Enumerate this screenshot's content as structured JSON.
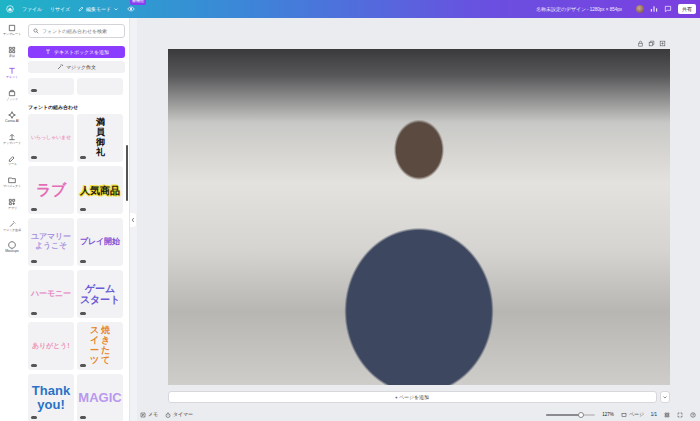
{
  "topbar": {
    "menus": [
      "ファイル",
      "リサイズ"
    ],
    "mode": "編集モード",
    "mode_badge": "新機能",
    "title": "名称未設定のデザイン - 1280px × 854px",
    "share": "共有"
  },
  "rail": [
    {
      "label": "テンプレート",
      "selected": false
    },
    {
      "label": "素材",
      "selected": false
    },
    {
      "label": "テキスト",
      "selected": true
    },
    {
      "label": "ブランド",
      "selected": false
    },
    {
      "label": "Canva AI",
      "selected": false
    },
    {
      "label": "アップロード",
      "selected": false
    },
    {
      "label": "ツール",
      "selected": false
    },
    {
      "label": "プロジェクト",
      "selected": false
    },
    {
      "label": "アプリ",
      "selected": false
    },
    {
      "label": "マジック生成",
      "selected": false
    },
    {
      "label": "Mockups",
      "selected": false
    }
  ],
  "panel": {
    "search_placeholder": "フォントの組み合わせを検索",
    "add_text": "テキストボックスを追加",
    "magic_write": "マジック作文",
    "section_title": "フォントの組み合わせ",
    "tiles": [
      {
        "lines": [
          "いらっしゃいませ"
        ],
        "vertical": false,
        "color": "#ee9cc2"
      },
      {
        "lines": [
          "満員御礼"
        ],
        "vertical": true,
        "color": "#111111"
      },
      {
        "lines": [
          "ラブ"
        ],
        "vertical": false,
        "color": "#e46db6"
      },
      {
        "lines": [
          "人気商品"
        ],
        "vertical": false,
        "color": "#1a1a1a",
        "outline": "#f3e12e"
      },
      {
        "lines": [
          "ユアマリー",
          "ようこそ"
        ],
        "vertical": false,
        "color": "#a995e0"
      },
      {
        "lines": [
          "プレイ開始"
        ],
        "vertical": false,
        "color": "#7a4ed4"
      },
      {
        "lines": [
          "ハーモニー"
        ],
        "vertical": false,
        "color": "#e58cc4"
      },
      {
        "lines": [
          "ゲーム",
          "スタート"
        ],
        "vertical": false,
        "color": "#6a5ad4"
      },
      {
        "lines": [
          "ありがとう!"
        ],
        "vertical": false,
        "color": "#ee96b4"
      },
      {
        "lines": [
          "焼きたて",
          "スイーツ"
        ],
        "vertical": true,
        "color": "#e5862a"
      },
      {
        "lines": [
          "Thank",
          "you!"
        ],
        "vertical": false,
        "color": "#2a72c6"
      },
      {
        "lines": [
          "MAGIC"
        ],
        "vertical": false,
        "color": "#b998ee"
      }
    ]
  },
  "page": {
    "add_page": "+ ページを追加"
  },
  "bottombar": {
    "notes": "メモ",
    "timer": "タイマー",
    "zoom": {
      "level": 0.72,
      "reading": "127%"
    },
    "pages_label": "ページ",
    "pages": "1/1"
  }
}
